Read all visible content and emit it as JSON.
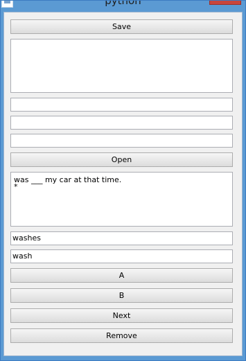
{
  "window": {
    "title": "python"
  },
  "buttons": {
    "save": "Save",
    "open": "Open",
    "a": "A",
    "b": "B",
    "next": "Next",
    "remove": "Remove"
  },
  "text_areas": {
    "top": "",
    "question": "was ___ my car at that time.\n*"
  },
  "fields": {
    "field1": "",
    "field2": "",
    "field3": "",
    "answer_a": "washes",
    "answer_b": "wash"
  }
}
